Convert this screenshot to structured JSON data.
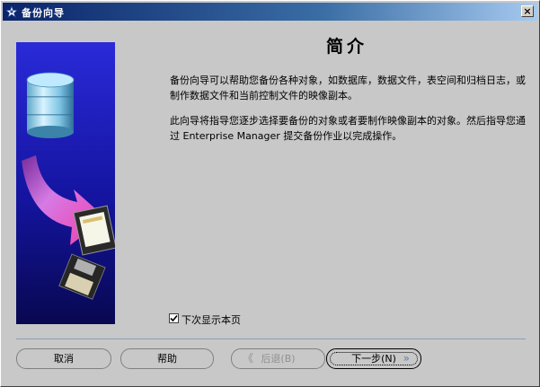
{
  "window": {
    "title": "备份向导",
    "close_label": "×"
  },
  "main": {
    "heading": "简介",
    "paragraph1": "备份向导可以帮助您备份各种对象，如数据库，数据文件，表空间和归档日志，或制作数据文件和当前控制文件的映像副本。",
    "paragraph2": "此向导将指导您逐步选择要备份的对象或者要制作映像副本的对象。然后指导您通过 Enterprise Manager 提交备份作业以完成操作。"
  },
  "checkbox": {
    "label": "下次显示本页",
    "checked": true
  },
  "buttons": {
    "cancel": "取消",
    "help": "帮助",
    "back": "后退(B)",
    "back_arrow": "《",
    "next": "下一步(N)",
    "next_arrow": "»"
  },
  "icons": {
    "title": "wizard-app-icon",
    "illustration": "database-to-disk-illustration"
  },
  "colors": {
    "titlebar_start": "#0a246a",
    "panel_blue": "#1a1fb0",
    "arrow_pink": "#e040c0"
  }
}
